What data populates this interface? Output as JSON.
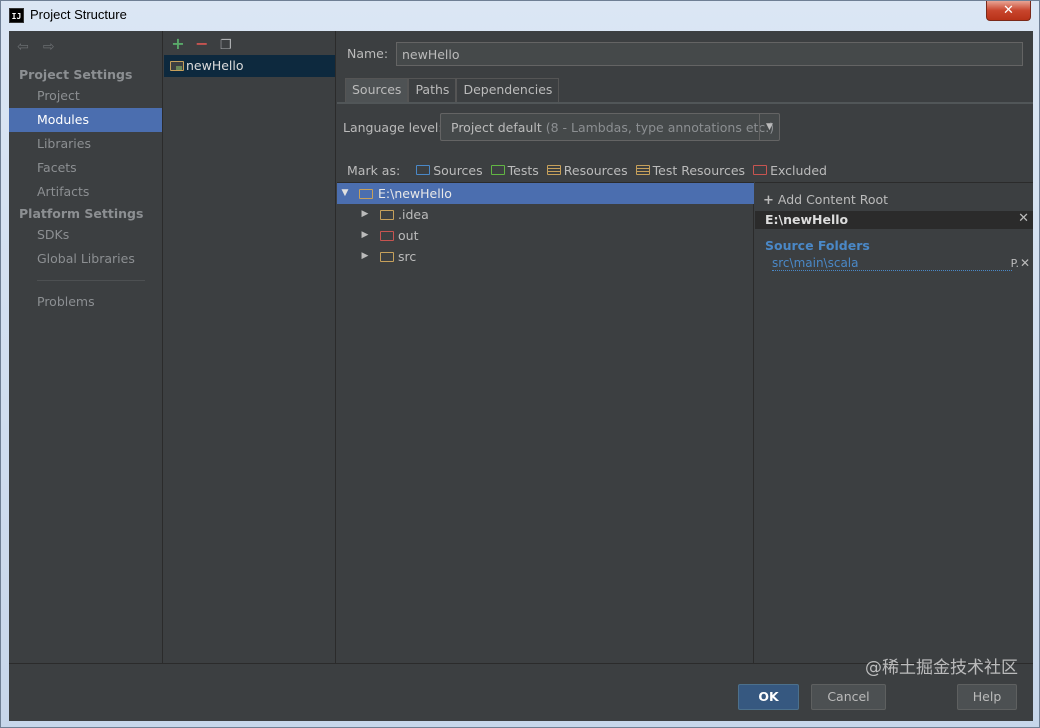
{
  "window": {
    "title": "Project Structure",
    "app_icon": "IJ",
    "close_label": "✕"
  },
  "nav": {
    "project_settings_label": "Project Settings",
    "project_items": [
      "Project",
      "Modules",
      "Libraries",
      "Facets",
      "Artifacts"
    ],
    "platform_settings_label": "Platform Settings",
    "platform_items": [
      "SDKs",
      "Global Libraries"
    ],
    "problems_label": "Problems",
    "selected": "Modules"
  },
  "modules": {
    "items": [
      "newHello"
    ]
  },
  "main": {
    "name_label": "Name:",
    "name_value": "newHello",
    "tabs": [
      "Sources",
      "Paths",
      "Dependencies"
    ],
    "active_tab": "Sources",
    "language_level_label": "Language level:",
    "language_level_value": "Project default",
    "language_level_hint": "(8 - Lambdas, type annotations etc.)",
    "mark_as_label": "Mark as:",
    "mark_as_options": [
      "Sources",
      "Tests",
      "Resources",
      "Test Resources",
      "Excluded"
    ]
  },
  "tree": {
    "root": "E:\\newHello",
    "children": [
      ".idea",
      "out",
      "src"
    ]
  },
  "content_root": {
    "add_label": "Add Content Root",
    "root_path": "E:\\newHello",
    "source_folders_label": "Source Folders",
    "source_folder": "src\\main\\scala",
    "source_folder_suffix": "P."
  },
  "buttons": {
    "ok": "OK",
    "cancel": "Cancel",
    "help": "Help"
  },
  "watermark": "@稀土掘金技术社区",
  "colors": {
    "selection": "#4b6eaf",
    "background": "#3c3f41",
    "accent_blue": "#4a88c7"
  }
}
